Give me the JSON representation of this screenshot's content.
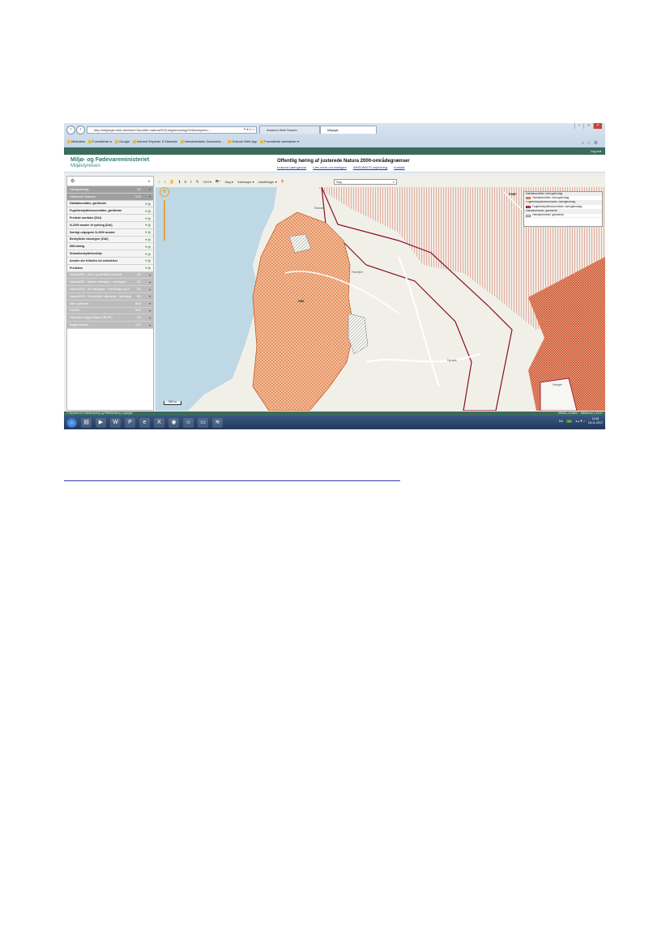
{
  "browser": {
    "address": "http://miljoegis.mim.dk/cbkort?&profile=natura2000-afgraensning2016&mapext=…",
    "address_suffix": "P ▾ C ×",
    "tabs": [
      {
        "label": "Amazon Web Search"
      },
      {
        "label": "Miljøgis"
      }
    ],
    "favorites": [
      "Biblioteks",
      "Foreslåede w",
      "Google",
      "Internet Explorer 8 Startside",
      "Netværkslister Danmarks ...",
      "Outlook Web App",
      "Foreslåede websteder ▾"
    ],
    "window_controls": [
      "–",
      "□",
      "×"
    ]
  },
  "app": {
    "login": "Log ind",
    "ministry": "Miljø- og Fødevareministeriet",
    "agency": "Miljøstyrelsen",
    "title": "Offentlig høring af justerede Natura 2000-områdegrænser",
    "links": [
      "Indsend høringssvar",
      "Læs mere om høringen",
      "WMS/WMTS vejledning",
      "Kontakt"
    ]
  },
  "sidebar": {
    "rows": [
      {
        "label": "Høringsforslag",
        "count": "2/2",
        "type": "grp"
      },
      {
        "label": "Gældende Grænser",
        "count": "1/10",
        "type": "grp"
      },
      {
        "label": "Habitatområder, gældende",
        "count": "",
        "type": "lyr"
      },
      {
        "label": "Fuglebeskyttelsesområder, gældende",
        "count": "",
        "type": "lyr"
      },
      {
        "label": "Fredede områder (DAI)",
        "count": "",
        "type": "lyr"
      },
      {
        "label": "N-2000 arealer til rydning (DAI)",
        "count": "",
        "type": "lyr"
      },
      {
        "label": "Særligt udpegede N-2000 arealer",
        "count": "",
        "type": "lyr"
      },
      {
        "label": "Beskyttede naturtyper (DAI)",
        "count": "",
        "type": "lyr"
      },
      {
        "label": "Illifredning",
        "count": "",
        "type": "lyr"
      },
      {
        "label": "Strandbeskyttelseslinje",
        "count": "",
        "type": "lyr"
      },
      {
        "label": "Arealer der fritrolles for udvidelser",
        "count": "",
        "type": "lyr"
      },
      {
        "label": "Fredskov",
        "count": "",
        "type": "lyr"
      },
      {
        "label": "Natura2000 - Arter og særskilte samlede",
        "count": "0/2",
        "type": "gray"
      },
      {
        "label": "Natura2000 - Marine naturtyper - høringsgrs",
        "count": "0/1",
        "type": "gray"
      },
      {
        "label": "Natura2000 - Sø naturtyper - Forhåndgrs og hr",
        "count": "0/1",
        "type": "gray"
      },
      {
        "label": "Natura2000 - Terrestriske naturtyper - høringsgr",
        "count": "0/3",
        "type": "gray"
      },
      {
        "label": "Adm. grænser",
        "count": "8/16",
        "type": "gray"
      },
      {
        "label": "DAI/Kat",
        "count": "8/32",
        "type": "gray"
      },
      {
        "label": "Hélsloske baggrundskort (BDFE)",
        "count": "0/6",
        "type": "gray"
      },
      {
        "label": "Baggrundskort",
        "count": "1/12",
        "type": "gray"
      }
    ]
  },
  "map": {
    "search_placeholder": "Søg",
    "tools": [
      "‹",
      "›",
      "✋",
      "ℹ",
      "≡",
      "i",
      "✎",
      "GST▾",
      "🖶 ▾",
      "Søg ▾",
      "Værktøjer ▾",
      "Indstillinger ▾"
    ],
    "legend": [
      {
        "label": "Habitatområder, høringsforslag",
        "swatch": "",
        "hdr": true
      },
      {
        "label": "Habitatområder, høringsforslag",
        "swatch": "orange"
      },
      {
        "label": "Fuglebeskyttelsesområder, høringsforslag",
        "swatch": "",
        "hdr": true
      },
      {
        "label": "Fuglebeskyttelsesområder, høringsforslag",
        "swatch": "red"
      },
      {
        "label": "Habitatområder, gældende",
        "swatch": "",
        "hdr": true
      },
      {
        "label": "Habitatområder, gældende",
        "swatch": "plain"
      }
    ],
    "area_labels": [
      "F96F",
      "H30"
    ],
    "towns": [
      "Rørvær",
      "Nyrøde",
      "Fandfjell",
      "Hanget"
    ],
    "scale": "500 m",
    "colors": {
      "sea": "#bfd8e6",
      "land": "#f1f0e8",
      "habitat": "#e8763a",
      "bird": "#8a0d2a"
    }
  },
  "statusbar": {
    "left": "© Styrelsen for Dataforsyning og Effektivisering, copyright",
    "right": "695284, 6195847 · Målforhold 1:10147"
  },
  "taskbar": {
    "lang": "DA",
    "time": "11:06",
    "date": "18-11-2017"
  },
  "page": {
    "caption_link": ""
  }
}
